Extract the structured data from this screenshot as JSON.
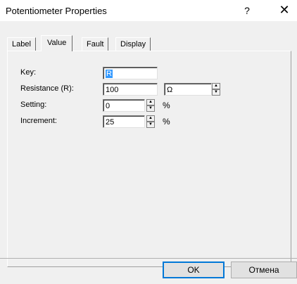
{
  "window": {
    "title": "Potentiometer Properties",
    "help_glyph": "?",
    "close_glyph": "✕"
  },
  "tabs": [
    {
      "label": "Label"
    },
    {
      "label": "Value"
    },
    {
      "label": "Fault"
    },
    {
      "label": "Display"
    }
  ],
  "form": {
    "key": {
      "label": "Key:",
      "value": "R"
    },
    "resistance": {
      "label": "Resistance (R):",
      "value": "100",
      "unit_value": "Ω"
    },
    "setting": {
      "label": "Setting:",
      "value": "0",
      "unit": "%"
    },
    "increment": {
      "label": "Increment:",
      "value": "25",
      "unit": "%"
    }
  },
  "buttons": {
    "ok": "OK",
    "cancel": "Отмена"
  },
  "colors": {
    "selection": "#3399ff",
    "focus_border": "#0078d7"
  }
}
